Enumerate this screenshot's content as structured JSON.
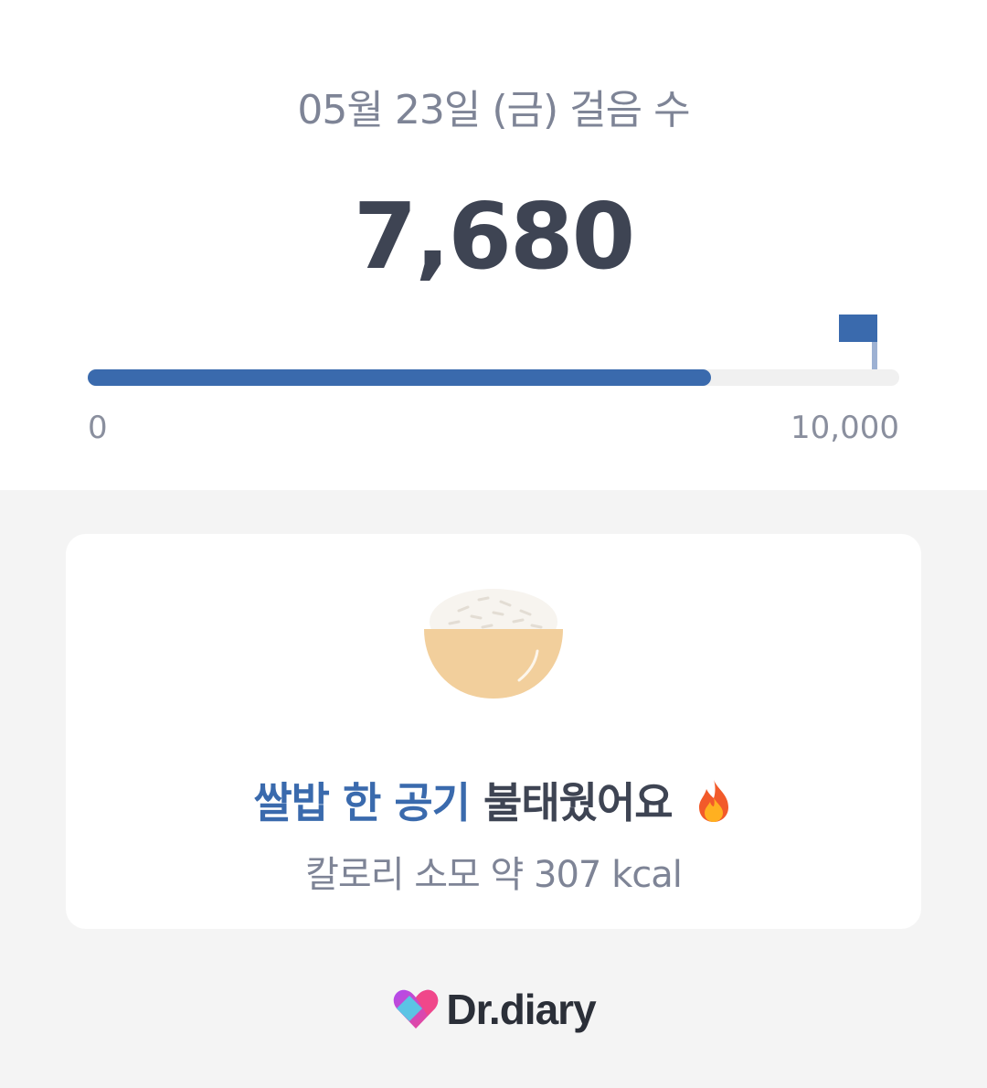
{
  "header": {
    "date_title": "05월 23일 (금) 걸음 수",
    "step_count": "7,680"
  },
  "progress": {
    "value": 7680,
    "goal": 10000,
    "min_label": "0",
    "max_label": "10,000",
    "accent_color": "#3a6aad"
  },
  "card": {
    "illustration": "rice-bowl-icon",
    "burn_highlight": "쌀밥 한 공기",
    "burn_rest": "불태웠어요",
    "burn_emoji": "fire-icon",
    "calorie_text": "칼로리 소모 약 307 kcal"
  },
  "brand": {
    "logo": "heart-logo-icon",
    "name": "Dr.diary"
  }
}
